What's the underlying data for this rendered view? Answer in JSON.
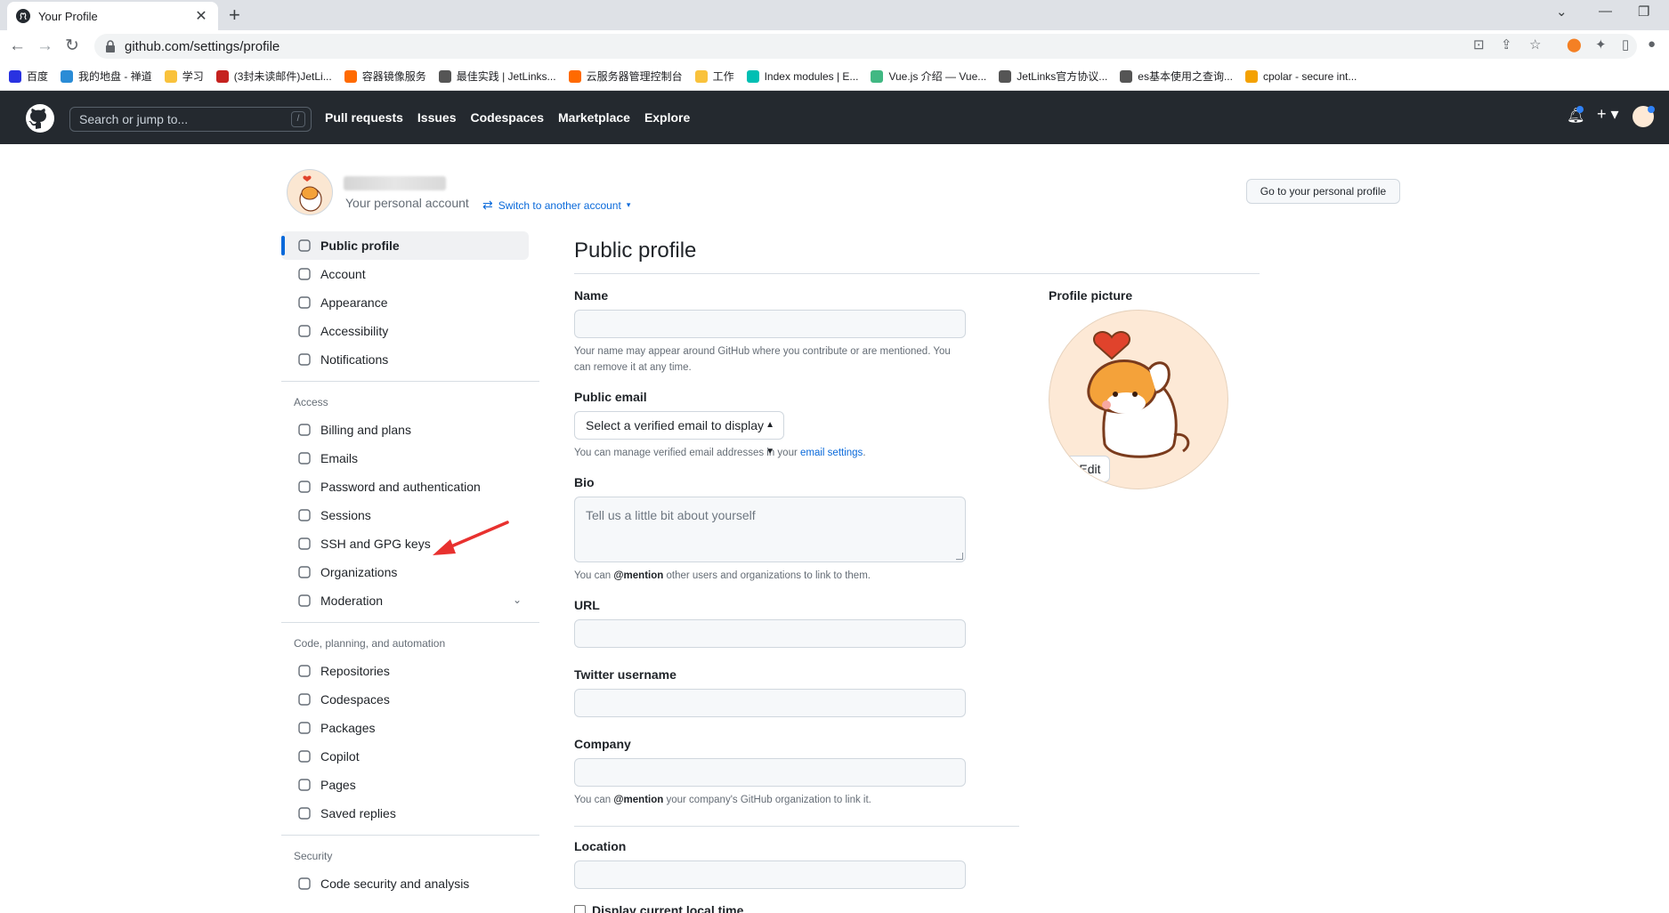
{
  "browser": {
    "tab_title": "Your Profile",
    "url": "github.com/settings/profile",
    "bookmarks": [
      {
        "label": "百度",
        "color": "#2932e1"
      },
      {
        "label": "我的地盘 - 禅道",
        "color": "#2a8cd6"
      },
      {
        "label": "学习",
        "color": "#f9c23c"
      },
      {
        "label": "(3封未读邮件)JetLi...",
        "color": "#c5221f"
      },
      {
        "label": "容器镜像服务",
        "color": "#ff6a00"
      },
      {
        "label": "最佳实践 | JetLinks...",
        "color": "#555555"
      },
      {
        "label": "云服务器管理控制台",
        "color": "#ff6a00"
      },
      {
        "label": "工作",
        "color": "#f9c23c"
      },
      {
        "label": "Index modules | E...",
        "color": "#00bfb3"
      },
      {
        "label": "Vue.js 介绍 — Vue...",
        "color": "#41b883"
      },
      {
        "label": "JetLinks官方协议...",
        "color": "#555555"
      },
      {
        "label": "es基本使用之查询...",
        "color": "#555555"
      },
      {
        "label": "cpolar - secure int...",
        "color": "#f4a100"
      }
    ]
  },
  "header": {
    "search_placeholder": "Search or jump to...",
    "search_key": "/",
    "nav": [
      "Pull requests",
      "Issues",
      "Codespaces",
      "Marketplace",
      "Explore"
    ]
  },
  "account": {
    "subtitle": "Your personal account",
    "switch_label": "Switch to another account",
    "go_profile_button": "Go to your personal profile"
  },
  "sidebar": {
    "top_items": [
      {
        "label": "Public profile",
        "icon": "person-icon",
        "active": true
      },
      {
        "label": "Account",
        "icon": "gear-icon"
      },
      {
        "label": "Appearance",
        "icon": "paintbrush-icon"
      },
      {
        "label": "Accessibility",
        "icon": "accessibility-icon"
      },
      {
        "label": "Notifications",
        "icon": "bell-icon"
      }
    ],
    "access_title": "Access",
    "access_items": [
      {
        "label": "Billing and plans",
        "icon": "credit-card-icon"
      },
      {
        "label": "Emails",
        "icon": "mail-icon"
      },
      {
        "label": "Password and authentication",
        "icon": "shield-icon"
      },
      {
        "label": "Sessions",
        "icon": "broadcast-icon"
      },
      {
        "label": "SSH and GPG keys",
        "icon": "key-icon"
      },
      {
        "label": "Organizations",
        "icon": "organization-icon"
      },
      {
        "label": "Moderation",
        "icon": "report-icon"
      }
    ],
    "code_title": "Code, planning, and automation",
    "code_items": [
      {
        "label": "Repositories",
        "icon": "repo-icon"
      },
      {
        "label": "Codespaces",
        "icon": "codespaces-icon"
      },
      {
        "label": "Packages",
        "icon": "package-icon"
      },
      {
        "label": "Copilot",
        "icon": "copilot-icon"
      },
      {
        "label": "Pages",
        "icon": "browser-icon"
      },
      {
        "label": "Saved replies",
        "icon": "reply-icon"
      }
    ],
    "security_title": "Security",
    "security_items": [
      {
        "label": "Code security and analysis",
        "icon": "codescan-icon"
      }
    ]
  },
  "main": {
    "title": "Public profile",
    "name_label": "Name",
    "name_value": "",
    "name_note": "Your name may appear around GitHub where you contribute or are mentioned. You can remove it at any time.",
    "email_label": "Public email",
    "email_select": "Select a verified email to display",
    "email_note_pre": "You can manage verified email addresses in your ",
    "email_note_link": "email settings",
    "email_note_post": ".",
    "bio_label": "Bio",
    "bio_placeholder": "Tell us a little bit about yourself",
    "bio_note_pre": "You can ",
    "bio_note_mention": "@mention",
    "bio_note_post": " other users and organizations to link to them.",
    "url_label": "URL",
    "twitter_label": "Twitter username",
    "company_label": "Company",
    "company_note_pre": "You can ",
    "company_note_mention": "@mention",
    "company_note_post": " your company's GitHub organization to link it.",
    "location_label": "Location",
    "local_time_label": "Display current local time"
  },
  "picture": {
    "label": "Profile picture",
    "edit_label": "Edit"
  },
  "colors": {
    "header_bg": "#24292f",
    "accent": "#0969da",
    "annotation_arrow": "#e8312f"
  }
}
